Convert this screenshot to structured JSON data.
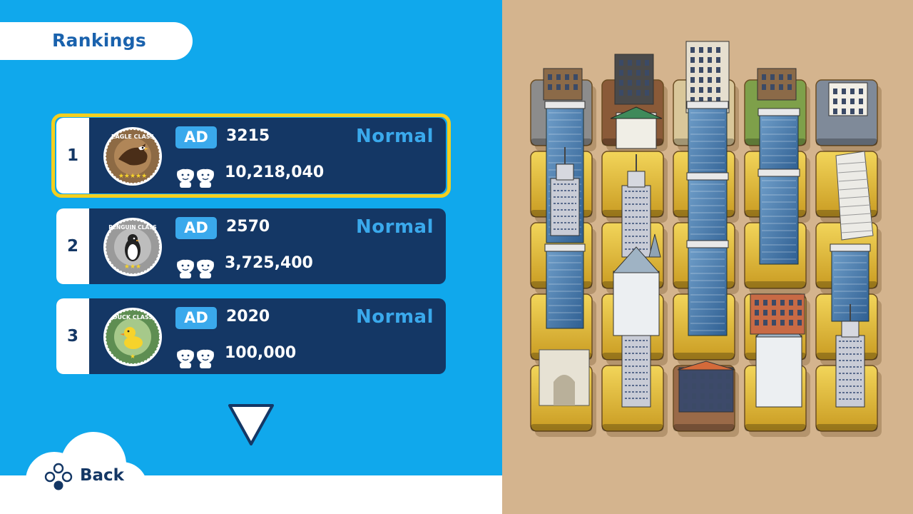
{
  "header": {
    "title": "Rankings"
  },
  "rankings": [
    {
      "rank": "1",
      "badge": "EAGLE CLASS",
      "stars": 5,
      "badge_color": "#8d6a44",
      "ad_label": "AD",
      "ad_value": "3215",
      "difficulty": "Normal",
      "score": "10,218,040",
      "selected": true
    },
    {
      "rank": "2",
      "badge": "PENGUIN CLASS",
      "stars": 3,
      "badge_color": "#9a9a9a",
      "ad_label": "AD",
      "ad_value": "2570",
      "difficulty": "Normal",
      "score": "3,725,400",
      "selected": false
    },
    {
      "rank": "3",
      "badge": "DUCK CLASS",
      "stars": 1,
      "badge_color": "#5e8e52",
      "ad_label": "AD",
      "ad_value": "2020",
      "difficulty": "Normal",
      "score": "100,000",
      "selected": false
    }
  ],
  "footer": {
    "back_label": "Back"
  },
  "board": {
    "columns": 5,
    "rows": 5,
    "description_icons": [
      "skyscraper-icon",
      "castle-icon",
      "leaning-tower-icon",
      "arc-de-triomphe-icon",
      "townhouse-icon",
      "pagoda-icon"
    ]
  },
  "colors": {
    "sky_blue": "#10a8ec",
    "navy": "#143765",
    "accent_blue": "#3aa9ec",
    "highlight_yellow": "#f4cf1f",
    "sand": "#d4b48e"
  }
}
